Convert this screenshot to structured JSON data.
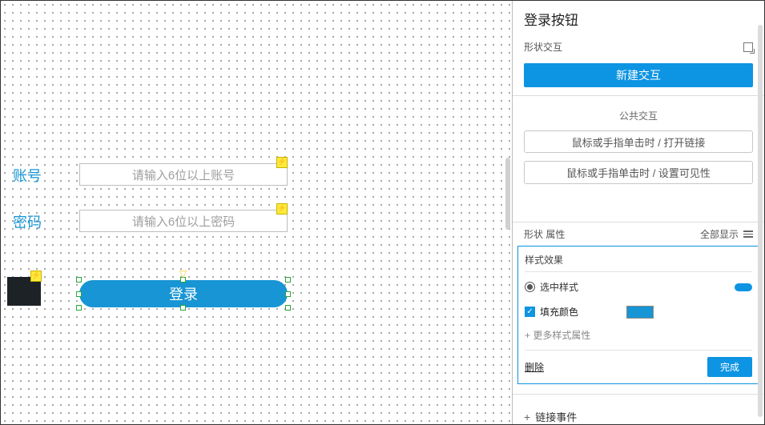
{
  "canvas": {
    "account_label": "账号",
    "password_label": "密码",
    "account_placeholder": "请输入6位以上账号",
    "password_placeholder": "请输入6位以上密码",
    "login_text": "登录"
  },
  "panel": {
    "title": "登录按钮",
    "interaction_header": "形状交互",
    "new_interaction_btn": "新建交互",
    "public_interaction_header": "公共交互",
    "public_option_1": "鼠标或手指单击时 / 打开链接",
    "public_option_2": "鼠标或手指单击时 / 设置可见性",
    "shape_props": "形状 属性",
    "show_all": "全部显示",
    "style_effect": "样式效果",
    "selected_style": "选中样式",
    "fill_color_label": "填充颜色",
    "fill_color": "#1795d4",
    "more_props": "+ 更多样式属性",
    "delete": "删除",
    "done": "完成",
    "add_link_event": "链接事件"
  }
}
